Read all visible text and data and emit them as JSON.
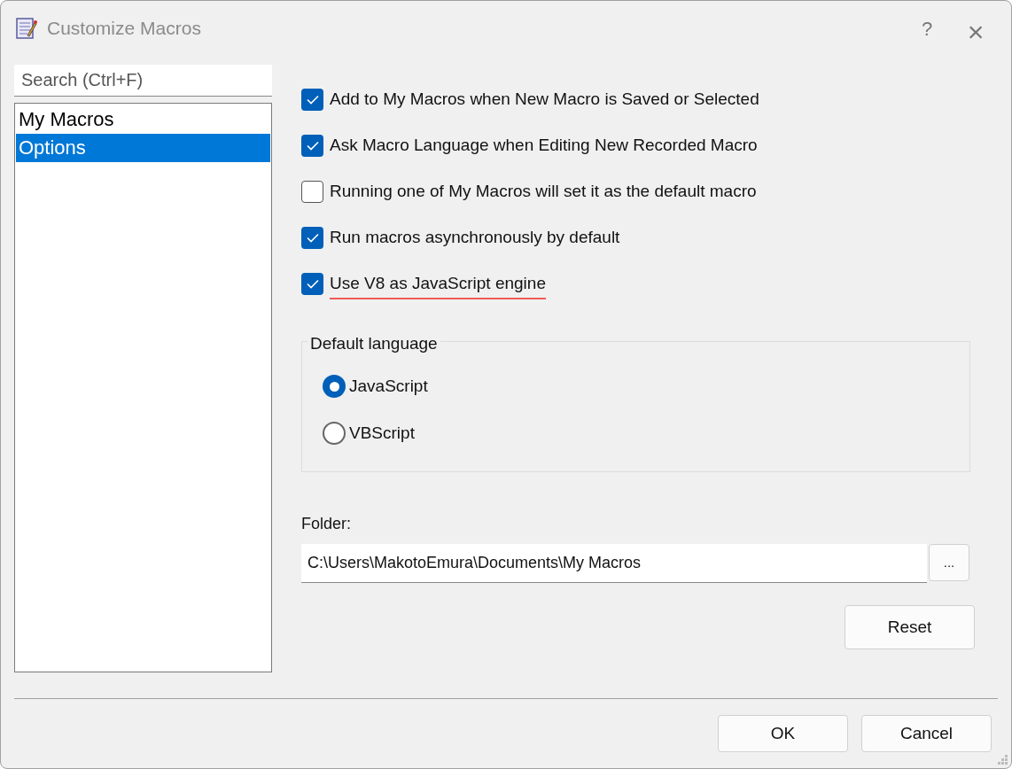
{
  "window": {
    "title": "Customize Macros",
    "help_button": "?",
    "close_button": "×"
  },
  "sidebar": {
    "search": {
      "placeholder": "Search (Ctrl+F)"
    },
    "items": [
      {
        "label": "My Macros",
        "selected": false
      },
      {
        "label": "Options",
        "selected": true
      }
    ]
  },
  "options": [
    {
      "label": "Add to My Macros when New Macro is Saved or Selected",
      "checked": true,
      "underlined": false
    },
    {
      "label": "Ask Macro Language when Editing New Recorded Macro",
      "checked": true,
      "underlined": false
    },
    {
      "label": "Running one of My Macros will set it as the default macro",
      "checked": false,
      "underlined": false
    },
    {
      "label": "Run macros asynchronously by default",
      "checked": true,
      "underlined": false
    },
    {
      "label": "Use V8 as JavaScript engine",
      "checked": true,
      "underlined": true
    }
  ],
  "default_language": {
    "title": "Default language",
    "choices": [
      {
        "label": "JavaScript",
        "selected": true
      },
      {
        "label": "VBScript",
        "selected": false
      }
    ]
  },
  "folder": {
    "label": "Folder:",
    "value": "C:\\Users\\MakotoEmura\\Documents\\My Macros",
    "browse_button": "..."
  },
  "reset_button": "Reset",
  "buttons": [
    "OK",
    "Cancel"
  ]
}
